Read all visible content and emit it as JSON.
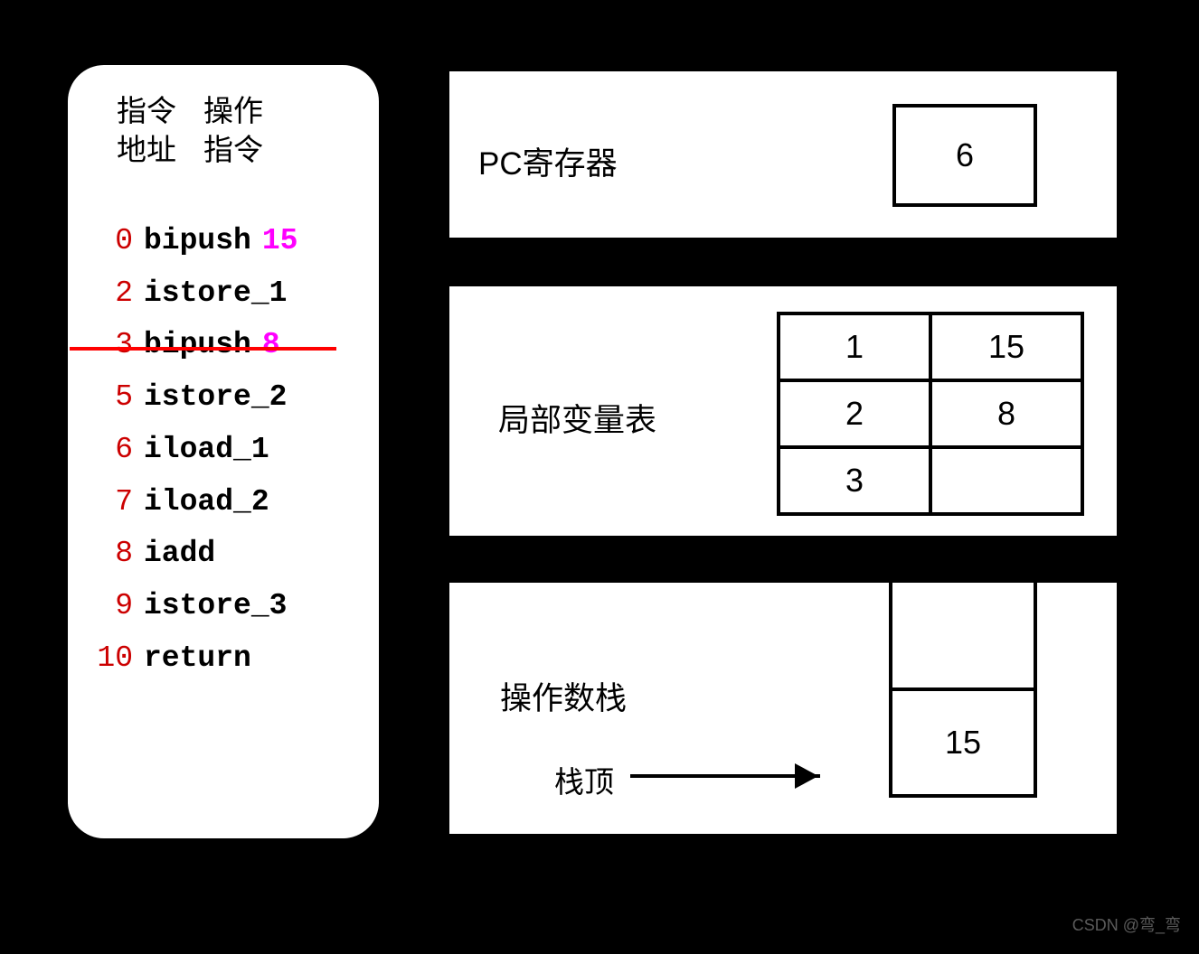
{
  "bytecode": {
    "headers": {
      "addr_line1": "指令",
      "addr_line2": "地址",
      "op_line1": "操作",
      "op_line2": "指令"
    },
    "instructions": [
      {
        "addr": "0",
        "opcode": "bipush",
        "operand": "15"
      },
      {
        "addr": "2",
        "opcode": "istore_1",
        "operand": ""
      },
      {
        "addr": "3",
        "opcode": "bipush",
        "operand": "8"
      },
      {
        "addr": "5",
        "opcode": "istore_2",
        "operand": ""
      },
      {
        "addr": "6",
        "opcode": "iload_1",
        "operand": ""
      },
      {
        "addr": "7",
        "opcode": "iload_2",
        "operand": ""
      },
      {
        "addr": "8",
        "opcode": "iadd",
        "operand": ""
      },
      {
        "addr": "9",
        "opcode": "istore_3",
        "operand": ""
      },
      {
        "addr": "10",
        "opcode": "return",
        "operand": ""
      }
    ]
  },
  "pc_register": {
    "label": "PC寄存器",
    "value": "6"
  },
  "local_variable_table": {
    "label": "局部变量表",
    "rows": [
      {
        "index": "1",
        "value": "15"
      },
      {
        "index": "2",
        "value": "8"
      },
      {
        "index": "3",
        "value": ""
      }
    ]
  },
  "operand_stack": {
    "label": "操作数栈",
    "top_label": "栈顶",
    "cells": [
      {
        "value": ""
      },
      {
        "value": "15"
      }
    ]
  },
  "watermark": "CSDN @弯_弯"
}
